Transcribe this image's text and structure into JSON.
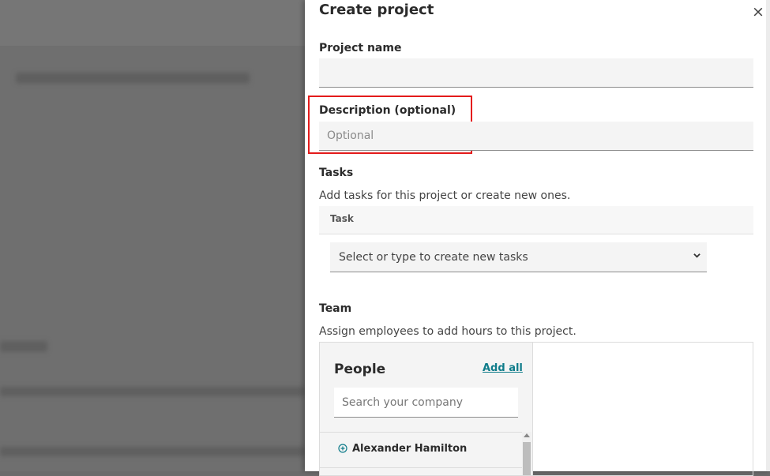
{
  "dialog": {
    "title": "Create project",
    "close_symbol": "×"
  },
  "fields": {
    "project_name": {
      "label": "Project name",
      "value": "",
      "placeholder": ""
    },
    "description": {
      "label": "Description (optional)",
      "value": "",
      "placeholder": "Optional"
    }
  },
  "tasks": {
    "label": "Tasks",
    "help": "Add tasks for this project or create new ones.",
    "column_header": "Task",
    "select_placeholder": "Select or type to create new tasks"
  },
  "team": {
    "label": "Team",
    "help": "Assign employees to add hours to this project.",
    "people_title": "People",
    "add_all": "Add all",
    "search_placeholder": "Search your company",
    "people": [
      "Alexander Hamilton"
    ]
  },
  "colors": {
    "accent": "#0f7c8a",
    "highlight": "#e41b1b"
  },
  "icons": [
    "close-icon",
    "chevron-down-icon",
    "add-circle-icon"
  ]
}
